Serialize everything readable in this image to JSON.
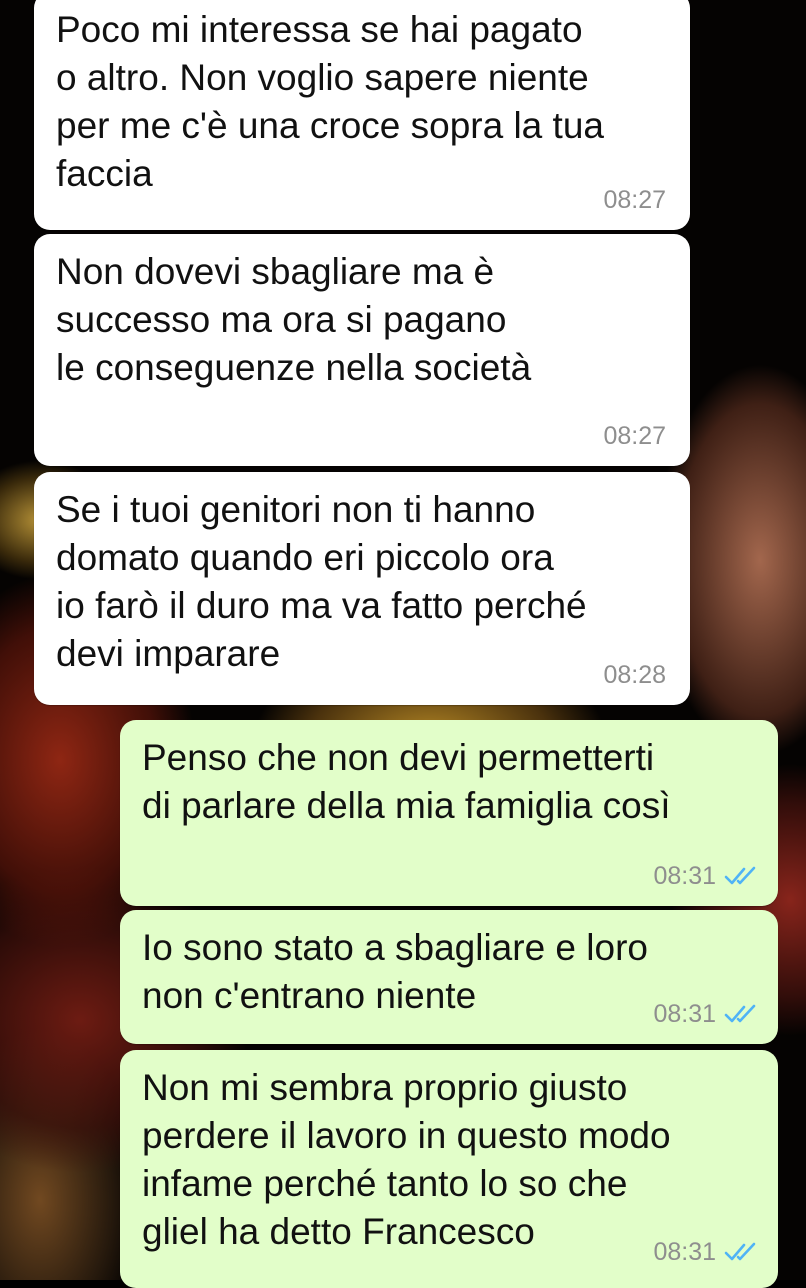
{
  "messages": [
    {
      "direction": "incoming",
      "text": "Poco mi interessa se hai pagato\no altro. Non voglio sapere niente\nper me c'è una croce sopra la tua\nfaccia",
      "time": "08:27"
    },
    {
      "direction": "incoming",
      "text": "Non dovevi sbagliare ma è\nsuccesso ma ora si pagano\nle conseguenze nella società",
      "time": "08:27"
    },
    {
      "direction": "incoming",
      "text": "Se i tuoi genitori non ti hanno\ndomato quando eri piccolo ora\nio farò il duro ma va fatto perché\ndevi imparare",
      "time": "08:28"
    },
    {
      "direction": "outgoing",
      "text": "Penso che non devi permetterti\ndi parlare della mia famiglia così",
      "time": "08:31",
      "status": "read"
    },
    {
      "direction": "outgoing",
      "text": "Io sono stato a sbagliare e loro\nnon c'entrano niente",
      "time": "08:31",
      "status": "read"
    },
    {
      "direction": "outgoing",
      "text": "Non mi sembra proprio giusto\nperdere il lavoro in questo modo\ninfame perché tanto lo so che\ngliel ha detto Francesco",
      "time": "08:31",
      "status": "read"
    }
  ],
  "colors": {
    "incoming_bubble": "#ffffff",
    "outgoing_bubble": "#e2fec9",
    "read_ticks": "#4fb3f6",
    "timestamp": "#8e8e8e"
  },
  "icons": {
    "read_receipt": "double-check-icon"
  }
}
